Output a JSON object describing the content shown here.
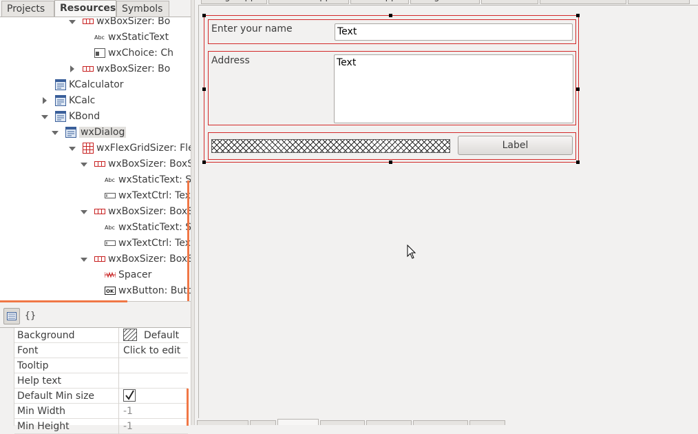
{
  "left_panel": {
    "tabs": [
      "Projects",
      "Resources",
      "Symbols"
    ],
    "active_tab": "Resources",
    "tree": [
      {
        "label": "wxBoxSizer: Bo",
        "icon": "boxsizer-icon",
        "indent": 3,
        "expander": "down",
        "partial_top": true
      },
      {
        "label": "wxStaticText",
        "icon": "statictext-icon",
        "indent": 4,
        "expander": ""
      },
      {
        "label": "wxChoice: Ch",
        "icon": "choice-icon",
        "indent": 4,
        "expander": ""
      },
      {
        "label": "wxBoxSizer: Bo",
        "icon": "boxsizer-icon",
        "indent": 3,
        "expander": "right"
      },
      {
        "label": "KCalculator",
        "icon": "dialog-icon",
        "indent": 1,
        "expander": ""
      },
      {
        "label": "KCalc",
        "icon": "dialog-icon",
        "indent": 1,
        "expander": "right"
      },
      {
        "label": "KBond",
        "icon": "dialog-icon",
        "indent": 1,
        "expander": "down"
      },
      {
        "label": "wxDialog",
        "icon": "dialog-icon",
        "indent": 2,
        "expander": "down",
        "selected": true
      },
      {
        "label": "wxFlexGridSizer: Flex",
        "icon": "flexgridsizer-icon",
        "indent": 3,
        "expander": "down"
      },
      {
        "label": "wxBoxSizer: BoxSiz",
        "icon": "boxsizer-icon",
        "indent": 4,
        "expander": "down"
      },
      {
        "label": "wxStaticText: Sta",
        "icon": "statictext-icon",
        "indent": 5,
        "expander": ""
      },
      {
        "label": "wxTextCtrl: TextC",
        "icon": "textctrl-icon",
        "indent": 5,
        "expander": ""
      },
      {
        "label": "wxBoxSizer: BoxSiz",
        "icon": "boxsizer-icon",
        "indent": 4,
        "expander": "down"
      },
      {
        "label": "wxStaticText: Sta",
        "icon": "statictext-icon",
        "indent": 5,
        "expander": ""
      },
      {
        "label": "wxTextCtrl: TextC",
        "icon": "textctrl-icon",
        "indent": 5,
        "expander": ""
      },
      {
        "label": "wxBoxSizer: BoxSiz",
        "icon": "boxsizer-icon",
        "indent": 4,
        "expander": "down"
      },
      {
        "label": "Spacer",
        "icon": "spacer-icon",
        "indent": 5,
        "expander": ""
      },
      {
        "label": "wxButton: Button",
        "icon": "button-icon",
        "indent": 5,
        "expander": ""
      }
    ],
    "properties": [
      {
        "name": "Background",
        "value": "Default",
        "swatch": true
      },
      {
        "name": "Font",
        "value": "Click to edit"
      },
      {
        "name": "Tooltip",
        "value": ""
      },
      {
        "name": "Help text",
        "value": ""
      },
      {
        "name": "Default Min size",
        "value": "",
        "checkbox": true
      },
      {
        "name": "Min Width",
        "value": "-1",
        "muted": true
      },
      {
        "name": "Min Height",
        "value": "-1",
        "muted": true
      }
    ],
    "prop_toolbar": {
      "props_icon": "property-grid-icon",
      "events_label": "{}"
    }
  },
  "editor": {
    "file_tabs": [
      "wxAgetapp",
      "FormFlexapp",
      "KCalcapp",
      "wxAgeForm",
      "KCalcForm",
      "FormFlexForm",
      "KBondForm"
    ],
    "dialog": {
      "name_label": "Enter your name",
      "name_value": "Text",
      "address_label": "Address",
      "address_value": "Text",
      "button_label": "Label"
    }
  },
  "colors": {
    "sizer_outline": "#d22828",
    "accent": "#f07746",
    "background": "#f2f1f0"
  }
}
